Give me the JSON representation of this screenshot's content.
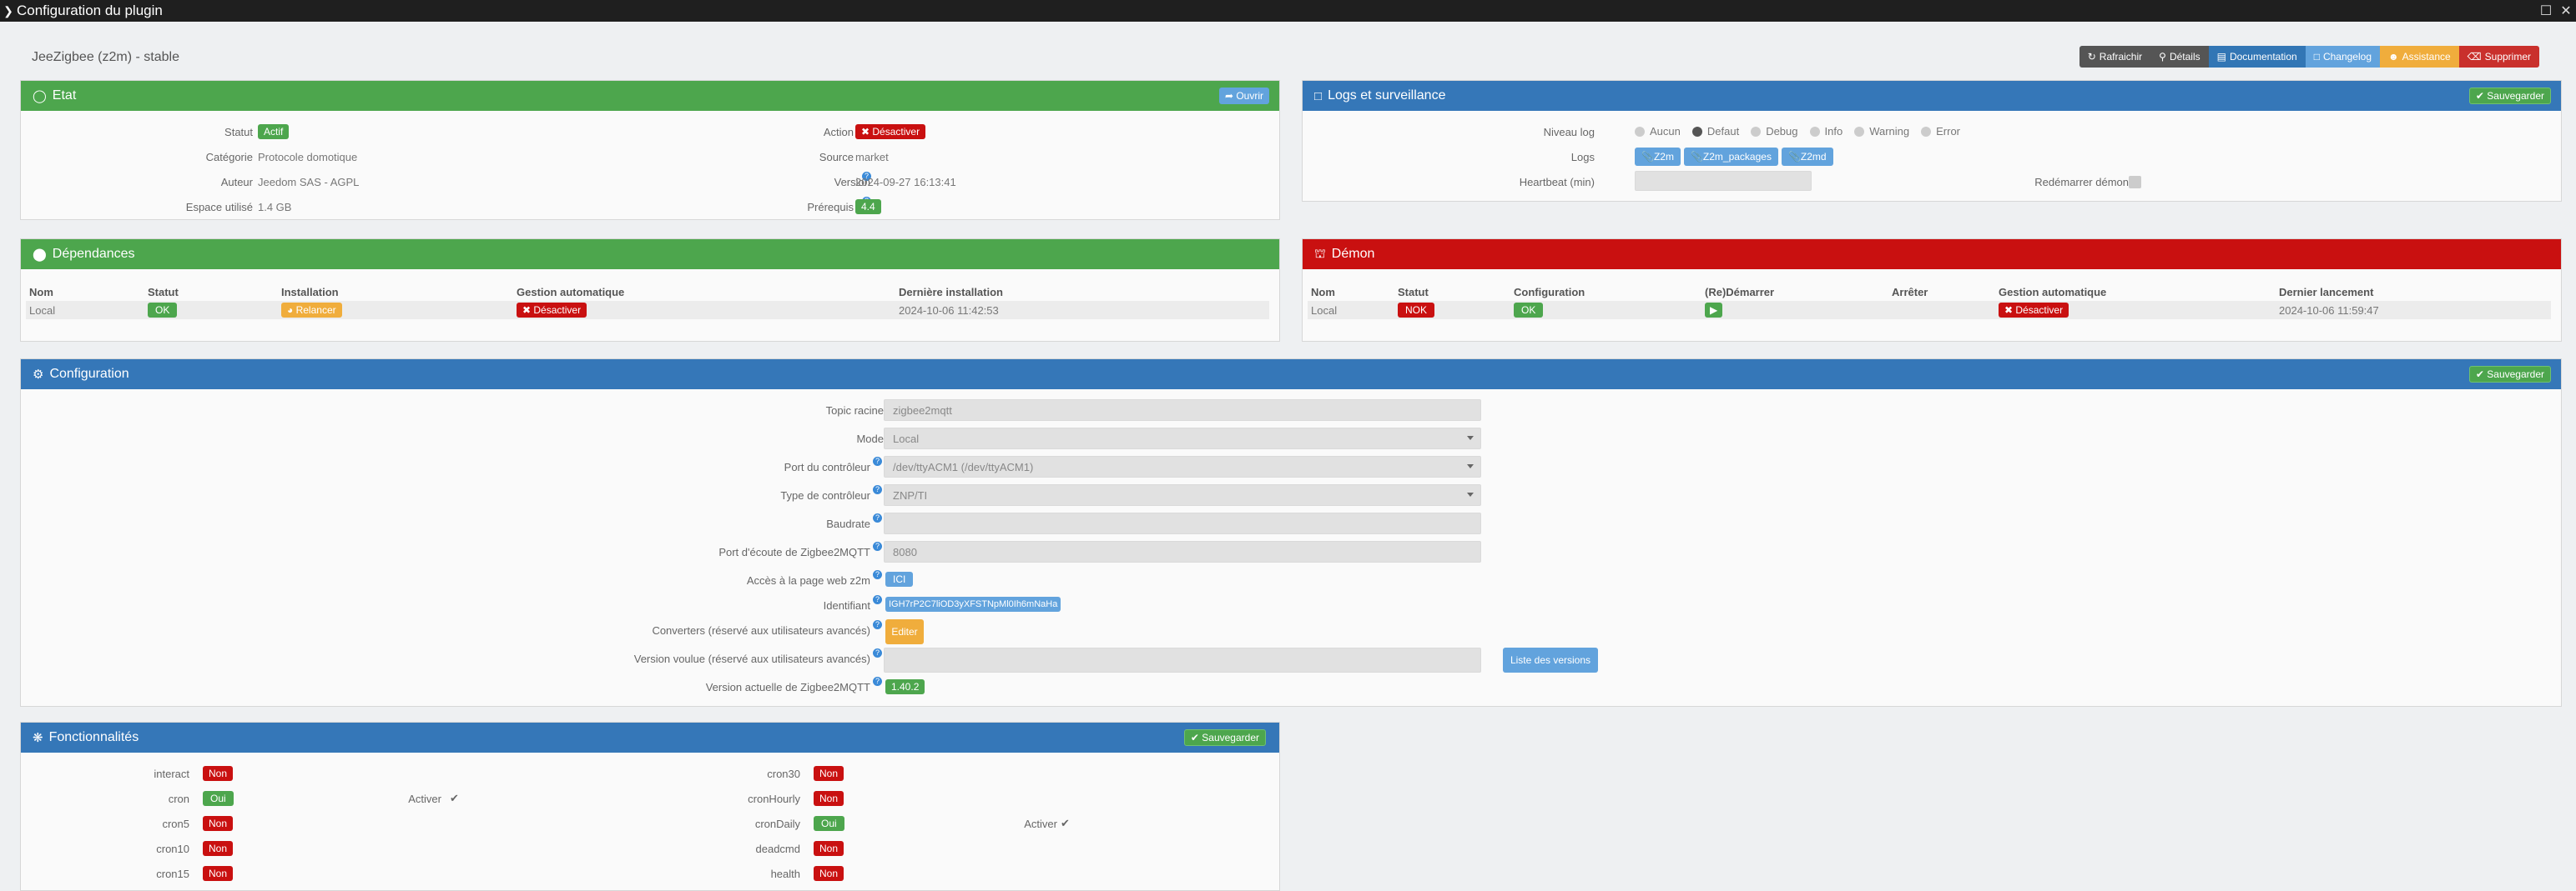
{
  "window": {
    "title": "Configuration du plugin"
  },
  "plugin": {
    "title": "JeeZigbee (z2m) - stable"
  },
  "toolbar": {
    "refresh": "Rafraichir",
    "details": "Détails",
    "documentation": "Documentation",
    "changelog": "Changelog",
    "assistance": "Assistance",
    "delete": "Supprimer"
  },
  "etat": {
    "title": "Etat",
    "open": "Ouvrir",
    "statut_label": "Statut",
    "statut_value": "Actif",
    "categorie_label": "Catégorie",
    "categorie_value": "Protocole domotique",
    "auteur_label": "Auteur",
    "auteur_value": "Jeedom SAS - AGPL",
    "espace_label": "Espace utilisé",
    "espace_value": "1.4 GB",
    "action_label": "Action",
    "action_value": "Désactiver",
    "source_label": "Source",
    "source_value": "market",
    "version_label": "Version",
    "version_value": "2024-09-27 16:13:41",
    "prerequis_label": "Prérequis",
    "prerequis_value": "4.4"
  },
  "logs": {
    "title": "Logs et surveillance",
    "save": "Sauvegarder",
    "niveau_label": "Niveau log",
    "levels": [
      "Aucun",
      "Defaut",
      "Debug",
      "Info",
      "Warning",
      "Error"
    ],
    "selected_level": "Defaut",
    "logs_label": "Logs",
    "log_buttons": [
      "Z2m",
      "Z2m_packages",
      "Z2md"
    ],
    "heartbeat_label": "Heartbeat (min)",
    "restart_label": "Redémarrer démon"
  },
  "deps": {
    "title": "Dépendances",
    "headers": [
      "Nom",
      "Statut",
      "Installation",
      "Gestion automatique",
      "Dernière installation"
    ],
    "row": {
      "nom": "Local",
      "statut": "OK",
      "installation": "Relancer",
      "gestion": "Désactiver",
      "derniere": "2024-10-06 11:42:53"
    }
  },
  "demon": {
    "title": "Démon",
    "headers": [
      "Nom",
      "Statut",
      "Configuration",
      "(Re)Démarrer",
      "Arrêter",
      "Gestion automatique",
      "Dernier lancement"
    ],
    "row": {
      "nom": "Local",
      "statut": "NOK",
      "configuration": "OK",
      "gestion": "Désactiver",
      "dernier": "2024-10-06 11:59:47"
    }
  },
  "config": {
    "title": "Configuration",
    "save": "Sauvegarder",
    "topic_label": "Topic racine",
    "topic_value": "zigbee2mqtt",
    "mode_label": "Mode",
    "mode_value": "Local",
    "port_label": "Port du contrôleur",
    "port_value": "/dev/ttyACM1 (/dev/ttyACM1)",
    "type_label": "Type de contrôleur",
    "type_value": "ZNP/TI",
    "baudrate_label": "Baudrate",
    "baudrate_value": "",
    "ecoute_label": "Port d'écoute de Zigbee2MQTT",
    "ecoute_value": "8080",
    "acces_label": "Accès à la page web z2m",
    "acces_value": "ICI",
    "ident_label": "Identifiant",
    "ident_value": "IGH7rP2C7liOD3yXFSTNpMl0Ih6mNaHa",
    "converters_label": "Converters (réservé aux utilisateurs avancés)",
    "converters_value": "Editer",
    "voulue_label": "Version voulue (réservé aux utilisateurs avancés)",
    "voulue_value": "",
    "liste_versions": "Liste des versions",
    "actuelle_label": "Version actuelle de Zigbee2MQTT",
    "actuelle_value": "1.40.2"
  },
  "fonct": {
    "title": "Fonctionnalités",
    "save": "Sauvegarder",
    "activer": "Activer",
    "left": [
      {
        "name": "interact",
        "state": "Non"
      },
      {
        "name": "cron",
        "state": "Oui"
      },
      {
        "name": "cron5",
        "state": "Non"
      },
      {
        "name": "cron10",
        "state": "Non"
      },
      {
        "name": "cron15",
        "state": "Non"
      }
    ],
    "right": [
      {
        "name": "cron30",
        "state": "Non"
      },
      {
        "name": "cronHourly",
        "state": "Non"
      },
      {
        "name": "cronDaily",
        "state": "Oui"
      },
      {
        "name": "deadcmd",
        "state": "Non"
      },
      {
        "name": "health",
        "state": "Non"
      }
    ]
  },
  "colors": {
    "green": "#4da64d",
    "blue": "#3577b8",
    "red": "#c91010",
    "orange": "#f0ad3c"
  }
}
